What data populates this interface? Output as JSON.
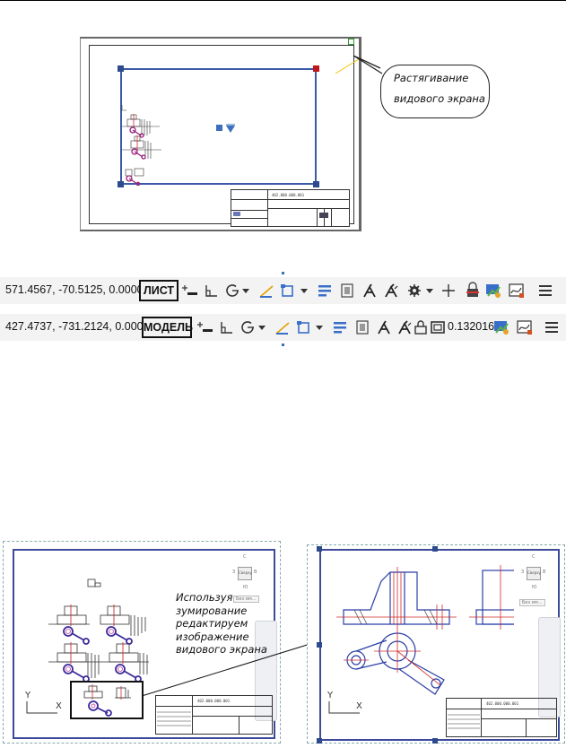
{
  "figure_top": {
    "callout_lines": [
      "Растягивание",
      "видового экрана"
    ],
    "title_block_number": "402.000.000.001"
  },
  "toolbar_sheet": {
    "coordinates": "571.4567, -70.5125, 0.0000",
    "mode_label": "ЛИСТ"
  },
  "toolbar_model": {
    "coordinates": "427.4737, -731.2124, 0.0000",
    "mode_label": "МОДЕЛЬ",
    "annotation_scale": "0.132016"
  },
  "figure_bottom_left": {
    "note_lines": [
      "Используя",
      "зумирование",
      "редактируем",
      "изображение",
      "видового экрана"
    ],
    "scale_dropdown": "Без им...",
    "viewcube_label": "Сверху",
    "viewcube_letters": {
      "north": "С",
      "west": "З",
      "east": "В",
      "south": "Ю"
    },
    "axis_y": "Y",
    "axis_x": "X",
    "title_block_number": "402.000.000.001"
  },
  "figure_bottom_right": {
    "scale_dropdown": "Без им...",
    "viewcube_label": "Сверху",
    "viewcube_letters": {
      "north": "С",
      "west": "З",
      "east": "В",
      "south": "Ю"
    },
    "axis_y": "Y",
    "axis_x": "X",
    "title_block_number": "402.000.000.001"
  },
  "colors": {
    "viewport_frame": "#3b5aa8",
    "grip_blue": "#2c4a8c",
    "grip_red": "#c0161c",
    "part_red": "#d22a2a",
    "part_blue": "#2b3fa8",
    "grip_green": "#2e9b2e"
  }
}
